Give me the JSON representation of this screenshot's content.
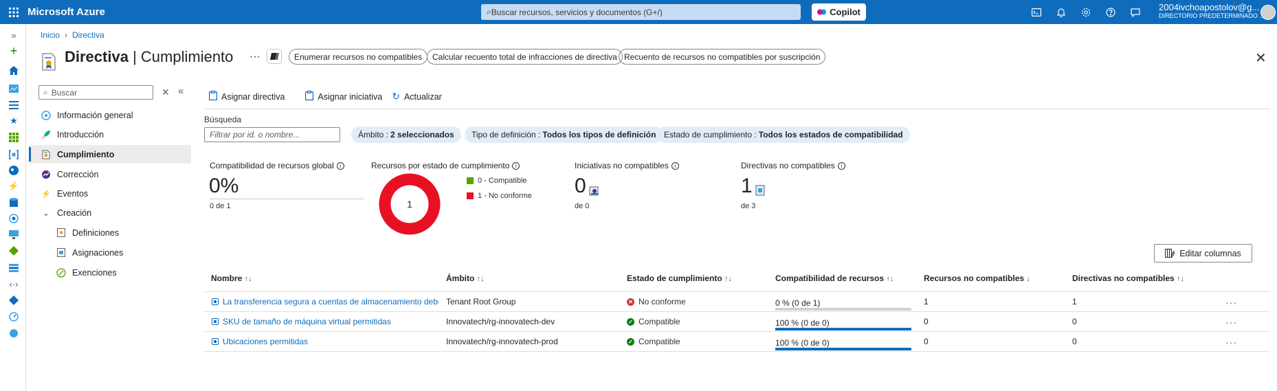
{
  "topbar": {
    "brand": "Microsoft Azure",
    "search_placeholder": "Buscar recursos, servicios y documentos (G+/)",
    "copilot_label": "Copilot",
    "user_email": "2004ivchoapostolov@g...",
    "user_directory": "DIRECTORIO PREDETERMINADO ..."
  },
  "breadcrumb": {
    "home": "Inicio",
    "current": "Directiva"
  },
  "header": {
    "title_bold": "Directiva",
    "title_rest": "| Cumplimiento",
    "more": "···",
    "actions": [
      "Enumerar recursos no compatibles",
      "Calcular recuento total de infracciones de directiva",
      "Recuento de recursos no compatibles por suscripción"
    ]
  },
  "sidebar": {
    "search_placeholder": "Buscar",
    "items": [
      {
        "label": "Información general"
      },
      {
        "label": "Introducción"
      },
      {
        "label": "Cumplimiento"
      },
      {
        "label": "Corrección"
      },
      {
        "label": "Eventos"
      },
      {
        "label": "Creación"
      },
      {
        "label": "Definiciones"
      },
      {
        "label": "Asignaciones"
      },
      {
        "label": "Exenciones"
      }
    ]
  },
  "toolbar": {
    "assign_policy": "Asignar directiva",
    "assign_initiative": "Asignar iniciativa",
    "refresh": "Actualizar"
  },
  "filters": {
    "search_label": "Búsqueda",
    "search_placeholder": "Filtrar por id. o nombre...",
    "scope_label": "Ámbito :",
    "scope_value": "2 seleccionados",
    "deftype_label": "Tipo de definición :",
    "deftype_value": "Todos los tipos de definición",
    "state_label": "Estado de cumplimiento :",
    "state_value": "Todos los estados de compatibilidad"
  },
  "summary": {
    "global_title": "Compatibilidad de recursos global",
    "global_value": "0%",
    "global_sub": "0 de 1",
    "donut_title": "Recursos por estado de cumplimiento",
    "donut_center": "1",
    "legend_compliant": "0 - Compatible",
    "legend_noncompliant": "1 - No conforme",
    "color_compliant": "#57a300",
    "color_noncompliant": "#e81123",
    "initiatives_title": "Iniciativas no compatibles",
    "initiatives_value": "0",
    "initiatives_sub": "de 0",
    "policies_title": "Directivas no compatibles",
    "policies_value": "1",
    "policies_sub": "de 3"
  },
  "table": {
    "edit_columns": "Editar columnas",
    "headers": {
      "name": "Nombre",
      "scope": "Ámbito",
      "state": "Estado de cumplimiento",
      "compat": "Compatibilidad de recursos",
      "res_nc": "Recursos no compatibles",
      "pol_nc": "Directivas no compatibles"
    },
    "rows": [
      {
        "name": "La transferencia segura a cuentas de almacenamiento debe estar habilitada",
        "scope": "Tenant Root Group",
        "state": "No conforme",
        "compat": "0 % (0 de 1)",
        "compat_fraction": 0,
        "res_nc": "1",
        "pol_nc": "1"
      },
      {
        "name": "SKU de tamaño de máquina virtual permitidas",
        "scope": "Innovatech/rg-innovatech-dev",
        "state": "Compatible",
        "compat": "100 % (0 de 0)",
        "compat_fraction": 1,
        "res_nc": "0",
        "pol_nc": "0"
      },
      {
        "name": "Ubicaciones permitidas",
        "scope": "Innovatech/rg-innovatech-prod",
        "state": "Compatible",
        "compat": "100 % (0 de 0)",
        "compat_fraction": 1,
        "res_nc": "0",
        "pol_nc": "0"
      }
    ]
  }
}
